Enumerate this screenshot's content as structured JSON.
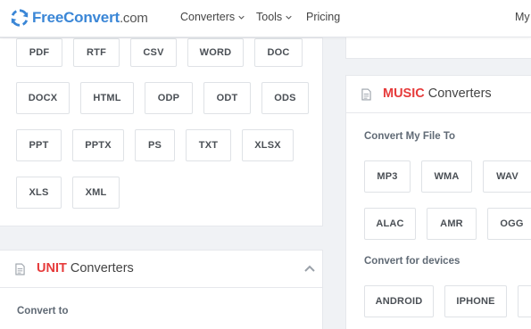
{
  "header": {
    "logo_main": "FreeConvert",
    "logo_suffix": ".com",
    "nav": {
      "converters": "Converters",
      "tools": "Tools",
      "pricing": "Pricing",
      "my": "My"
    }
  },
  "document_formats": {
    "row1": [
      "PDF",
      "RTF",
      "CSV",
      "WORD",
      "DOC"
    ],
    "row2": [
      "DOCX",
      "HTML",
      "ODP",
      "ODT",
      "ODS"
    ],
    "row3": [
      "PPT",
      "PPTX",
      "PS",
      "TXT",
      "XLSX"
    ],
    "row4": [
      "XLS",
      "XML"
    ]
  },
  "music": {
    "title_highlight": "MUSIC",
    "title_rest": " Converters",
    "convert_heading": "Convert My File To",
    "formats_row1": [
      "MP3",
      "WMA",
      "WAV"
    ],
    "formats_row2": [
      "ALAC",
      "AMR",
      "OGG"
    ],
    "devices_heading": "Convert for devices",
    "devices": [
      "ANDROID",
      "IPHONE"
    ]
  },
  "unit": {
    "title_highlight": "UNIT",
    "title_rest": " Converters",
    "convert_heading": "Convert to"
  },
  "colors": {
    "brand_blue": "#3a86d6",
    "highlight_red": "#e63b3b"
  }
}
